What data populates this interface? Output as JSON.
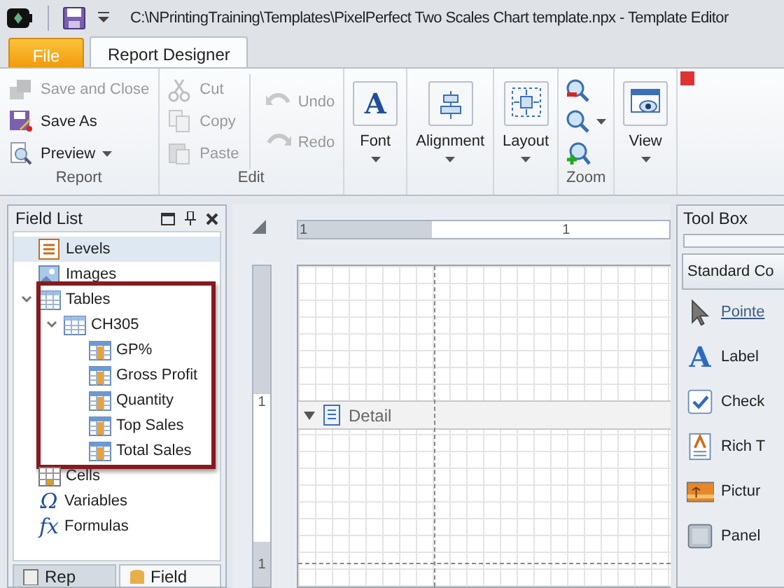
{
  "window": {
    "title": "C:\\NPrintingTraining\\Templates\\PixelPerfect Two Scales Chart template.npx - Template Editor"
  },
  "ribbon": {
    "tabs": [
      {
        "label": "File",
        "kind": "file",
        "selected": false
      },
      {
        "label": "Report Designer",
        "kind": "page",
        "selected": true
      }
    ],
    "groups": [
      {
        "label": "Report",
        "columns": [
          [
            {
              "kind": "small",
              "label": "Save and Close",
              "disabled": true,
              "dropdown": false
            },
            {
              "kind": "small",
              "label": "Save As",
              "disabled": false,
              "dropdown": false
            },
            {
              "kind": "small",
              "label": "Preview",
              "disabled": false,
              "dropdown": true
            }
          ]
        ]
      },
      {
        "label": "Edit",
        "columns": [
          [
            {
              "kind": "small",
              "label": "Cut",
              "disabled": true,
              "dropdown": false
            },
            {
              "kind": "small",
              "label": "Copy",
              "disabled": true,
              "dropdown": false
            },
            {
              "kind": "small",
              "label": "Paste",
              "disabled": true,
              "dropdown": false
            }
          ],
          [
            {
              "kind": "small",
              "label": "Undo",
              "disabled": true,
              "dropdown": false
            },
            {
              "kind": "small",
              "label": "Redo",
              "disabled": true,
              "dropdown": false
            }
          ]
        ]
      },
      {
        "columns": [
          [
            {
              "kind": "large",
              "label": "Font",
              "glyph": "A",
              "disabled": false,
              "dropdown": true
            }
          ]
        ]
      },
      {
        "columns": [
          [
            {
              "kind": "large",
              "label": "Alignment",
              "disabled": false,
              "dropdown": true
            }
          ]
        ]
      },
      {
        "columns": [
          [
            {
              "kind": "large",
              "label": "Layout",
              "disabled": false,
              "dropdown": true
            }
          ]
        ]
      },
      {
        "label": "Zoom",
        "columns": [
          [
            {
              "kind": "icon",
              "disabled": false,
              "dropdown": false
            },
            {
              "kind": "icon",
              "disabled": false,
              "dropdown": true
            },
            {
              "kind": "icon",
              "disabled": false,
              "dropdown": false
            }
          ]
        ]
      },
      {
        "columns": [
          [
            {
              "kind": "large",
              "label": "View",
              "disabled": false,
              "dropdown": true
            }
          ]
        ]
      }
    ]
  },
  "field_list": {
    "title": "Field List",
    "items": [
      {
        "label": "Levels",
        "selected": true
      },
      {
        "label": "Images",
        "selected": false
      },
      {
        "label": "Tables",
        "selected": false,
        "highlighted": true,
        "expanded": true,
        "children": [
          {
            "label": "CH305",
            "selected": false,
            "expanded": true,
            "children": [
              {
                "label": "GP%",
                "selected": false
              },
              {
                "label": "Gross Profit",
                "selected": false
              },
              {
                "label": "Quantity",
                "selected": false
              },
              {
                "label": "Top Sales",
                "selected": false
              },
              {
                "label": "Total Sales",
                "selected": false
              }
            ]
          }
        ]
      },
      {
        "label": "Cells",
        "selected": false
      },
      {
        "label": "Variables",
        "glyph": "Ω",
        "selected": false
      },
      {
        "label": "Formulas",
        "glyph": "fx",
        "selected": false
      }
    ],
    "tabs": [
      {
        "label": "Rep",
        "selected": false
      },
      {
        "label": "Field",
        "selected": true
      }
    ]
  },
  "designer": {
    "ruler_h_labels": [
      "1",
      "1"
    ],
    "ruler_v_labels": [
      "1",
      "1"
    ],
    "band": {
      "label": "Detail",
      "expanded": true
    }
  },
  "tool_box": {
    "title": "Tool Box",
    "category": "Standard Co",
    "items": [
      {
        "label": "Pointe",
        "selected": true
      },
      {
        "label": "Label",
        "glyph": "A",
        "selected": false
      },
      {
        "label": "Check",
        "selected": false
      },
      {
        "label": "Rich T",
        "selected": false
      },
      {
        "label": "Pictur",
        "selected": false
      },
      {
        "label": "Panel",
        "selected": false
      }
    ]
  }
}
